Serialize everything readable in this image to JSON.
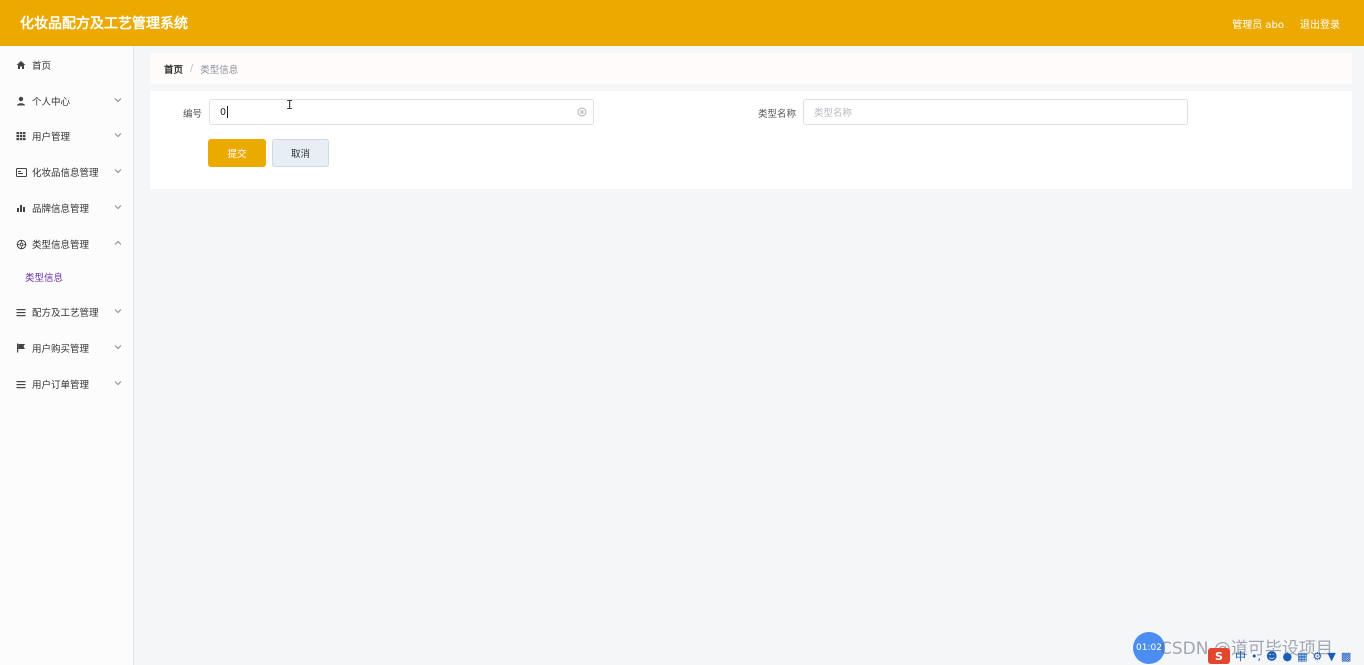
{
  "header": {
    "title": "化妆品配方及工艺管理系统",
    "user": "管理员 abo",
    "logout": "退出登录"
  },
  "sidebar": {
    "items": [
      {
        "label": "首页",
        "icon": "home-icon"
      },
      {
        "label": "个人中心",
        "icon": "user-icon"
      },
      {
        "label": "用户管理",
        "icon": "grid-icon"
      },
      {
        "label": "化妆品信息管理",
        "icon": "card-icon"
      },
      {
        "label": "品牌信息管理",
        "icon": "bar-chart-icon"
      },
      {
        "label": "类型信息管理",
        "icon": "settings-icon",
        "expanded": true,
        "children": [
          {
            "label": "类型信息"
          }
        ]
      },
      {
        "label": "配方及工艺管理",
        "icon": "list-icon"
      },
      {
        "label": "用户购买管理",
        "icon": "flag-icon"
      },
      {
        "label": "用户订单管理",
        "icon": "list-icon"
      }
    ]
  },
  "breadcrumb": {
    "home": "首页",
    "separator": "/",
    "current": "类型信息"
  },
  "form": {
    "id_label": "编号",
    "id_value": "0",
    "name_label": "类型名称",
    "name_placeholder": "类型名称",
    "submit": "提交",
    "cancel": "取消"
  },
  "overlay": {
    "timer": "01:02",
    "watermark": "CSDN @道可毕设项目",
    "ime_logo": "S",
    "ime_lang": "中"
  },
  "colors": {
    "header_bg": "#ecaa00",
    "primary_button": "#ebaa00",
    "active_sub_item": "#6b2fa8"
  }
}
